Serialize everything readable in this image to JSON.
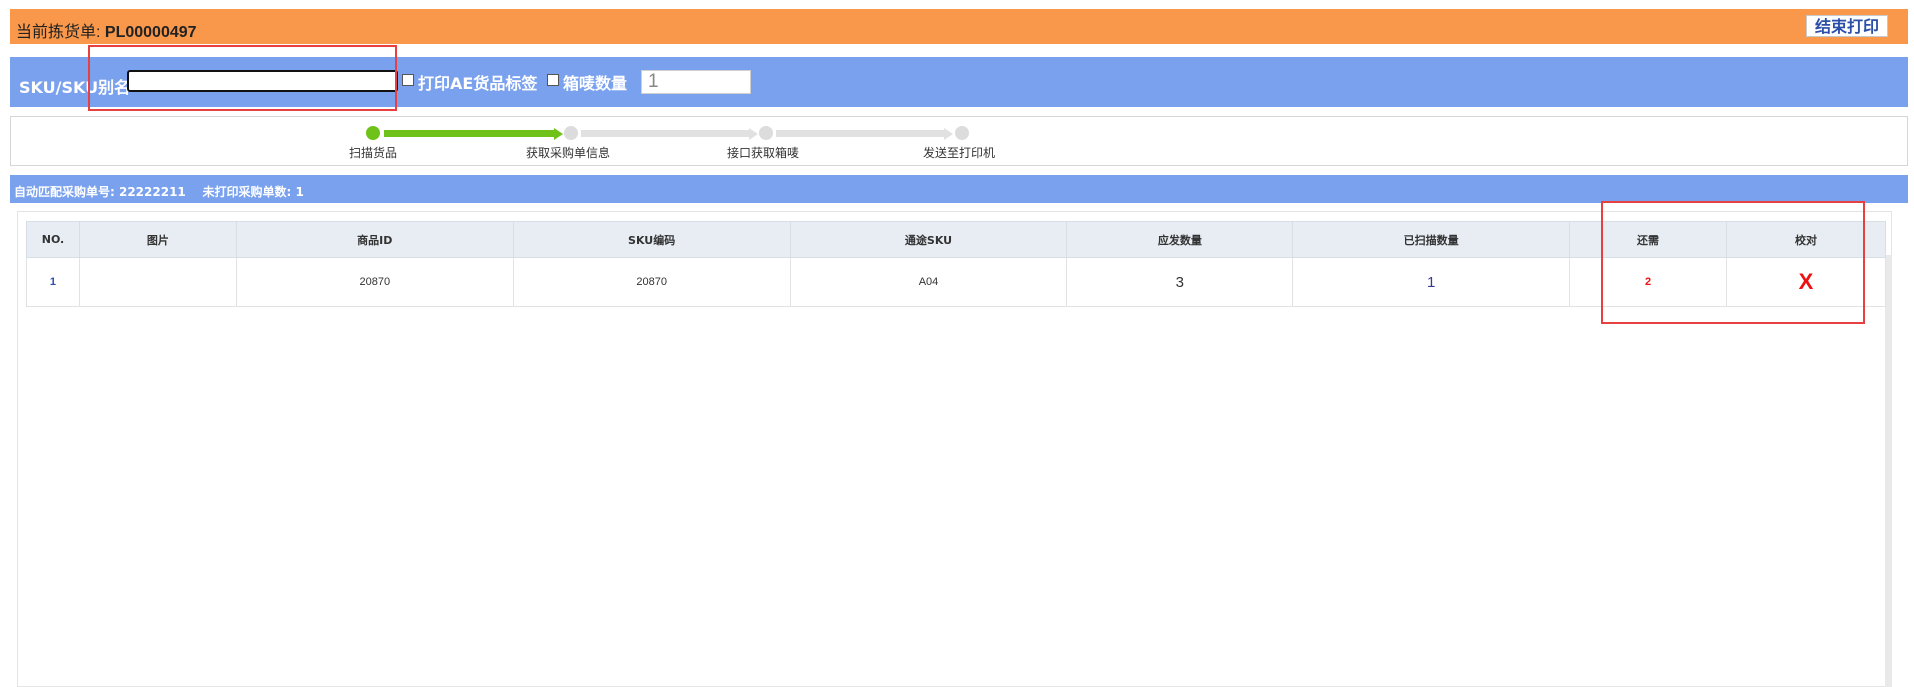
{
  "header": {
    "label": "当前拣货单: ",
    "picking_no": "PL00000497",
    "end_print": "结束打印"
  },
  "scan": {
    "sku_label": "SKU/SKU别名",
    "sku_value": "",
    "print_ae_label": "打印AE货品标签",
    "box_qty_label": "箱唛数量",
    "box_qty_value": "1"
  },
  "steps": [
    {
      "label": "扫描货品",
      "done": true
    },
    {
      "label": "获取采购单信息",
      "done": false
    },
    {
      "label": "接口获取箱唛",
      "done": false
    },
    {
      "label": "发送至打印机",
      "done": false
    }
  ],
  "info": {
    "text": "自动匹配采购单号: 22222211    未打印采购单数: 1"
  },
  "table": {
    "headers": [
      "NO.",
      "图片",
      "商品ID",
      "SKU编码",
      "通途SKU",
      "应发数量",
      "已扫描数量",
      "还需",
      "校对"
    ],
    "rows": [
      {
        "no": "1",
        "image": "",
        "product_id": "20870",
        "sku_code": "20870",
        "tongtu_sku": "A04",
        "ship_qty": "3",
        "scanned_qty": "1",
        "remaining": "2",
        "check": "X"
      }
    ]
  },
  "colors": {
    "header_bg": "#f9984a",
    "bar_bg": "#7aa1ee",
    "progress_done": "#6fc21a",
    "annotation_red": "#e74040"
  }
}
